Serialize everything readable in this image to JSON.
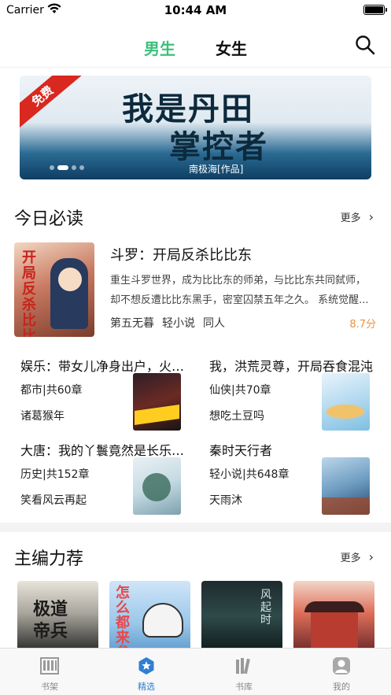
{
  "status": {
    "carrier": "Carrier",
    "time": "10:44 AM"
  },
  "topnav": {
    "tab_male": "男生",
    "tab_female": "女生",
    "active": "男生"
  },
  "banner": {
    "tag": "免费",
    "title_line1": "我是丹田",
    "title_line2": "掌控者",
    "author": "南极海[作品]",
    "page_count": 4,
    "active_page": 2
  },
  "today": {
    "title": "今日必读",
    "more": "更多",
    "featured": {
      "cover_text": "开局反杀比比东",
      "title": "斗罗：开局反杀比比东",
      "desc": "重生斗罗世界，成为比比东的师弟，与比比东共同弑师，却不想反遭比比东黑手，密室囚禁五年之久。 系统觉醒...",
      "author": "第五无暮",
      "category": "轻小说",
      "tag": "同人",
      "score": "8.7分"
    },
    "grid": [
      {
        "title": "娱乐：带女儿净身出户，火爆全网",
        "meta": "都市|共60章",
        "author": "诸葛猴年"
      },
      {
        "title": "我，洪荒灵尊，开局吞食混沌",
        "meta": "仙侠|共70章",
        "author": "想吃土豆吗"
      },
      {
        "title": "大唐：我的丫鬟竟然是长乐公主",
        "meta": "历史|共152章",
        "author": "笑看风云再起"
      },
      {
        "title": "秦时天行者",
        "meta": "轻小说|共648章",
        "author": "天雨沐"
      }
    ]
  },
  "editor": {
    "title": "主编力荐",
    "more": "更多",
    "covers": [
      {
        "text": "极道帝兵"
      },
      {
        "text": "怎么都来参军"
      },
      {
        "text": "风起时"
      },
      {
        "text": ""
      }
    ]
  },
  "tabbar": {
    "items": [
      {
        "label": "书架"
      },
      {
        "label": "精选"
      },
      {
        "label": "书库"
      },
      {
        "label": "我的"
      }
    ],
    "active": "精选",
    "accent": "#2f7fd4"
  }
}
